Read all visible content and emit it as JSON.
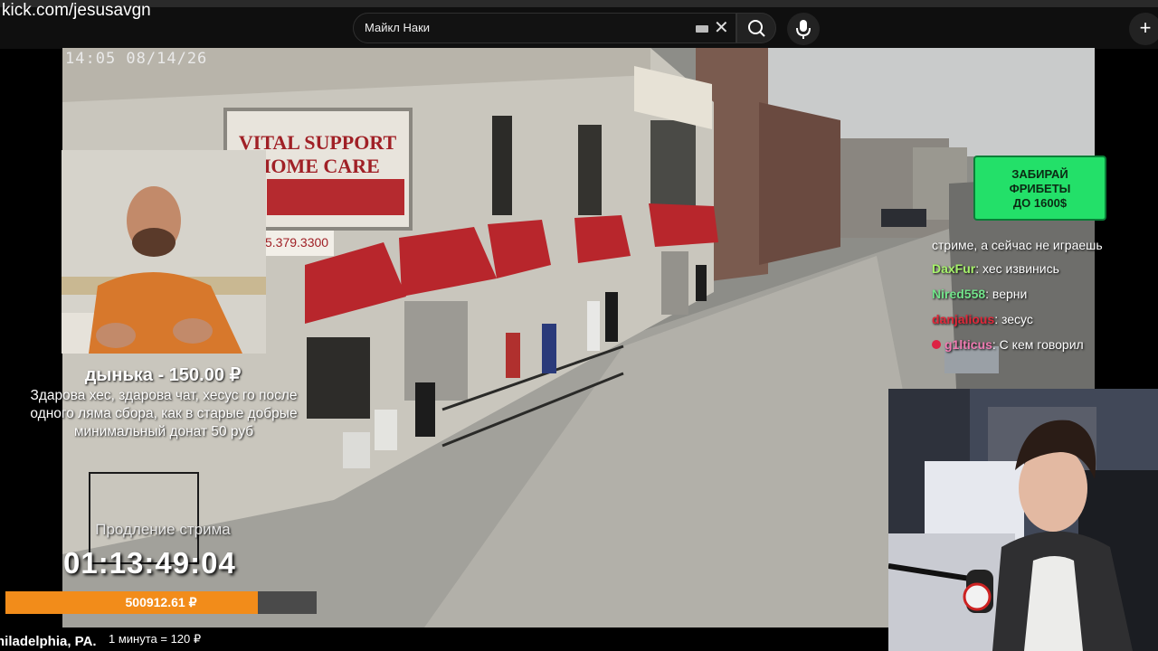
{
  "browser": {
    "url": "kick.com/jesusavgn",
    "search": {
      "value": "Майкл Наки"
    },
    "icons": [
      "keyboard-icon",
      "close-icon",
      "search-icon",
      "mic-icon",
      "plus-icon"
    ]
  },
  "camera": {
    "timestamp": "14:05  08/14/26",
    "sign": {
      "line1": "VITAL SUPPORT",
      "line2": "HOME CARE",
      "phone": "5.379.3300"
    }
  },
  "donation": {
    "title": "дынька - 150.00 ₽",
    "message": "Здарова хес, здарова чат, хесус го после одного ляма сбора, как в старые добрые минимальный донат 50 руб"
  },
  "stream_extension": {
    "label": "Продление стрима",
    "timer": "01:13:49:04",
    "amount": "500912.61 ₽",
    "progress_fraction": 0.81,
    "rate": "1 минута = 120 ₽",
    "location": "hiladelphia, PA."
  },
  "promo": {
    "line1": "ЗАБИРАЙ",
    "line2": "ФРИБЕТЫ",
    "line3": "ДО 1600$"
  },
  "chat": {
    "partial_line": "стриме, а сейчас не играешь",
    "messages": [
      {
        "user": "DaxFur",
        "color": "#a6f26b",
        "text": ": хес извинись"
      },
      {
        "user": "Nired558",
        "color": "#72e38a",
        "text": ": верни"
      },
      {
        "user": "danjalious",
        "color": "#e0283a",
        "text": ": зесус"
      },
      {
        "user": "g1lticus",
        "color": "#f07bb2",
        "text": ": С кем говорил"
      }
    ]
  },
  "colors": {
    "accent_orange": "#f28c1a",
    "promo_green": "#23e069",
    "awning_red": "#b8262c"
  }
}
